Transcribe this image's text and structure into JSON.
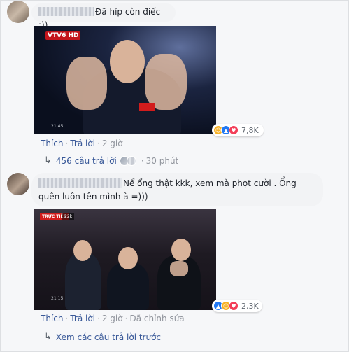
{
  "comments": [
    {
      "text": "Đã híp còn điếc :))",
      "reactions": {
        "icons": [
          "haha-icon",
          "like-icon",
          "love-icon"
        ],
        "count": "7,8K"
      },
      "actions": {
        "like": "Thích",
        "reply": "Trả lời",
        "time": "2 giờ"
      },
      "media": {
        "channel_logo": "VTV6 HD",
        "timestamp": "21:45"
      },
      "replies": {
        "label": "456 câu trả lời",
        "time": "30 phút"
      }
    },
    {
      "text": "Nể ổng thật kkk, xem mà phọt cười . Ổng quên luôn tên mình à =)))",
      "reactions": {
        "icons": [
          "like-icon",
          "haha-icon",
          "love-icon"
        ],
        "count": "2,3K"
      },
      "actions": {
        "like": "Thích",
        "reply": "Trả lời",
        "time": "2 giờ",
        "edited": "Đã chỉnh sửa"
      },
      "media": {
        "live_badge": "TRỰC TIẾP",
        "viewers": "22k",
        "timestamp": "21:15"
      },
      "previous_replies": "Xem các câu trả lời trước"
    }
  ],
  "colors": {
    "link": "#385898",
    "meta": "#90949c",
    "bubble": "#f2f3f5",
    "like": "#2078f4",
    "love": "#f33e58",
    "haha": "#f7b125"
  }
}
